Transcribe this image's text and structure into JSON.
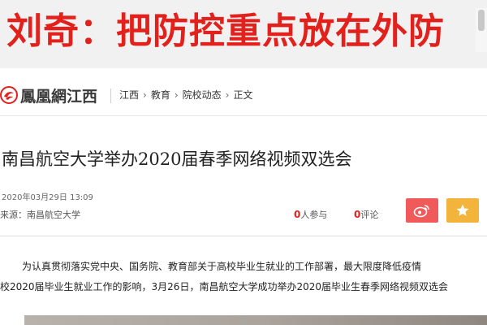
{
  "banner": {
    "text": "刘奇：把防控重点放在外防"
  },
  "site": {
    "logo_text": "鳳凰網江西",
    "logo_icon": "phoenix-logo-icon",
    "brand_color": "#e2211c"
  },
  "breadcrumb": {
    "items": [
      "江西",
      "教育",
      "院校动态",
      "正文"
    ],
    "separator": "›"
  },
  "article": {
    "title": "南昌航空大学举办2020届春季网络视频双选会",
    "date": "2020年03月29日 13:09",
    "source": "来源：南昌航空大学",
    "participants": {
      "count": "0",
      "label": "人参与"
    },
    "comments": {
      "count": "0",
      "label": "评论"
    },
    "paragraphs": [
      "为认真贯彻落实党中央、国务院、教育部关于高校毕业生就业的工作部署，最大限度降低疫情",
      "校2020届毕业生就业工作的影响，3月26日，南昌航空大学成功举办2020届毕业生春季网络视频双选会"
    ]
  },
  "share": {
    "weibo_icon": "weibo-icon",
    "weibo_color": "#f15a5a",
    "favorite_icon": "star-icon",
    "favorite_color": "#f2b43a"
  }
}
